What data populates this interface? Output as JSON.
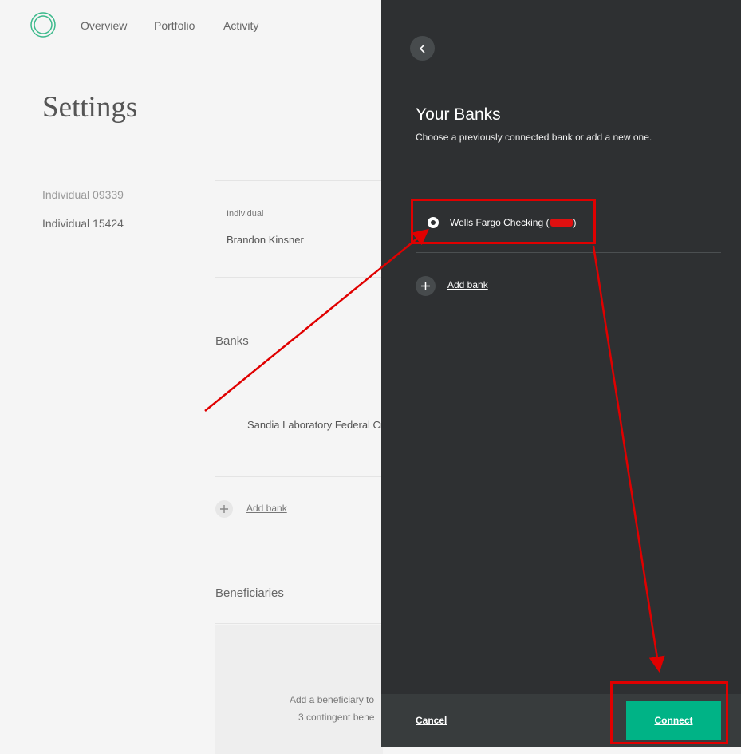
{
  "nav": {
    "items": [
      "Overview",
      "Portfolio",
      "Activity"
    ]
  },
  "page": {
    "title": "Settings"
  },
  "accounts": [
    "Individual 09339",
    "Individual 15424"
  ],
  "profile": {
    "type_label": "Individual",
    "name": "Brandon Kinsner"
  },
  "banks": {
    "section_title": "Banks",
    "existing_bank": "Sandia Laboratory Federal Cr",
    "add_bank": "Add bank"
  },
  "beneficiaries": {
    "section_title": "Beneficiaries",
    "line1": "Add a beneficiary to",
    "line2": "3 contingent bene"
  },
  "panel": {
    "title": "Your Banks",
    "subtitle": "Choose a previously connected bank or add a new one.",
    "bank_option_prefix": "Wells Fargo Checking (",
    "bank_option_suffix": ")",
    "add_bank": "Add bank",
    "cancel": "Cancel",
    "connect": "Connect"
  },
  "colors": {
    "panel_bg": "#2e3032",
    "accent": "#00b386",
    "annotation": "#e00000",
    "logo": "#3bb98b"
  },
  "icons": {
    "logo": "ring-logo-icon",
    "back": "chevron-left-icon",
    "radio": "radio-selected-icon",
    "add": "plus-icon"
  }
}
